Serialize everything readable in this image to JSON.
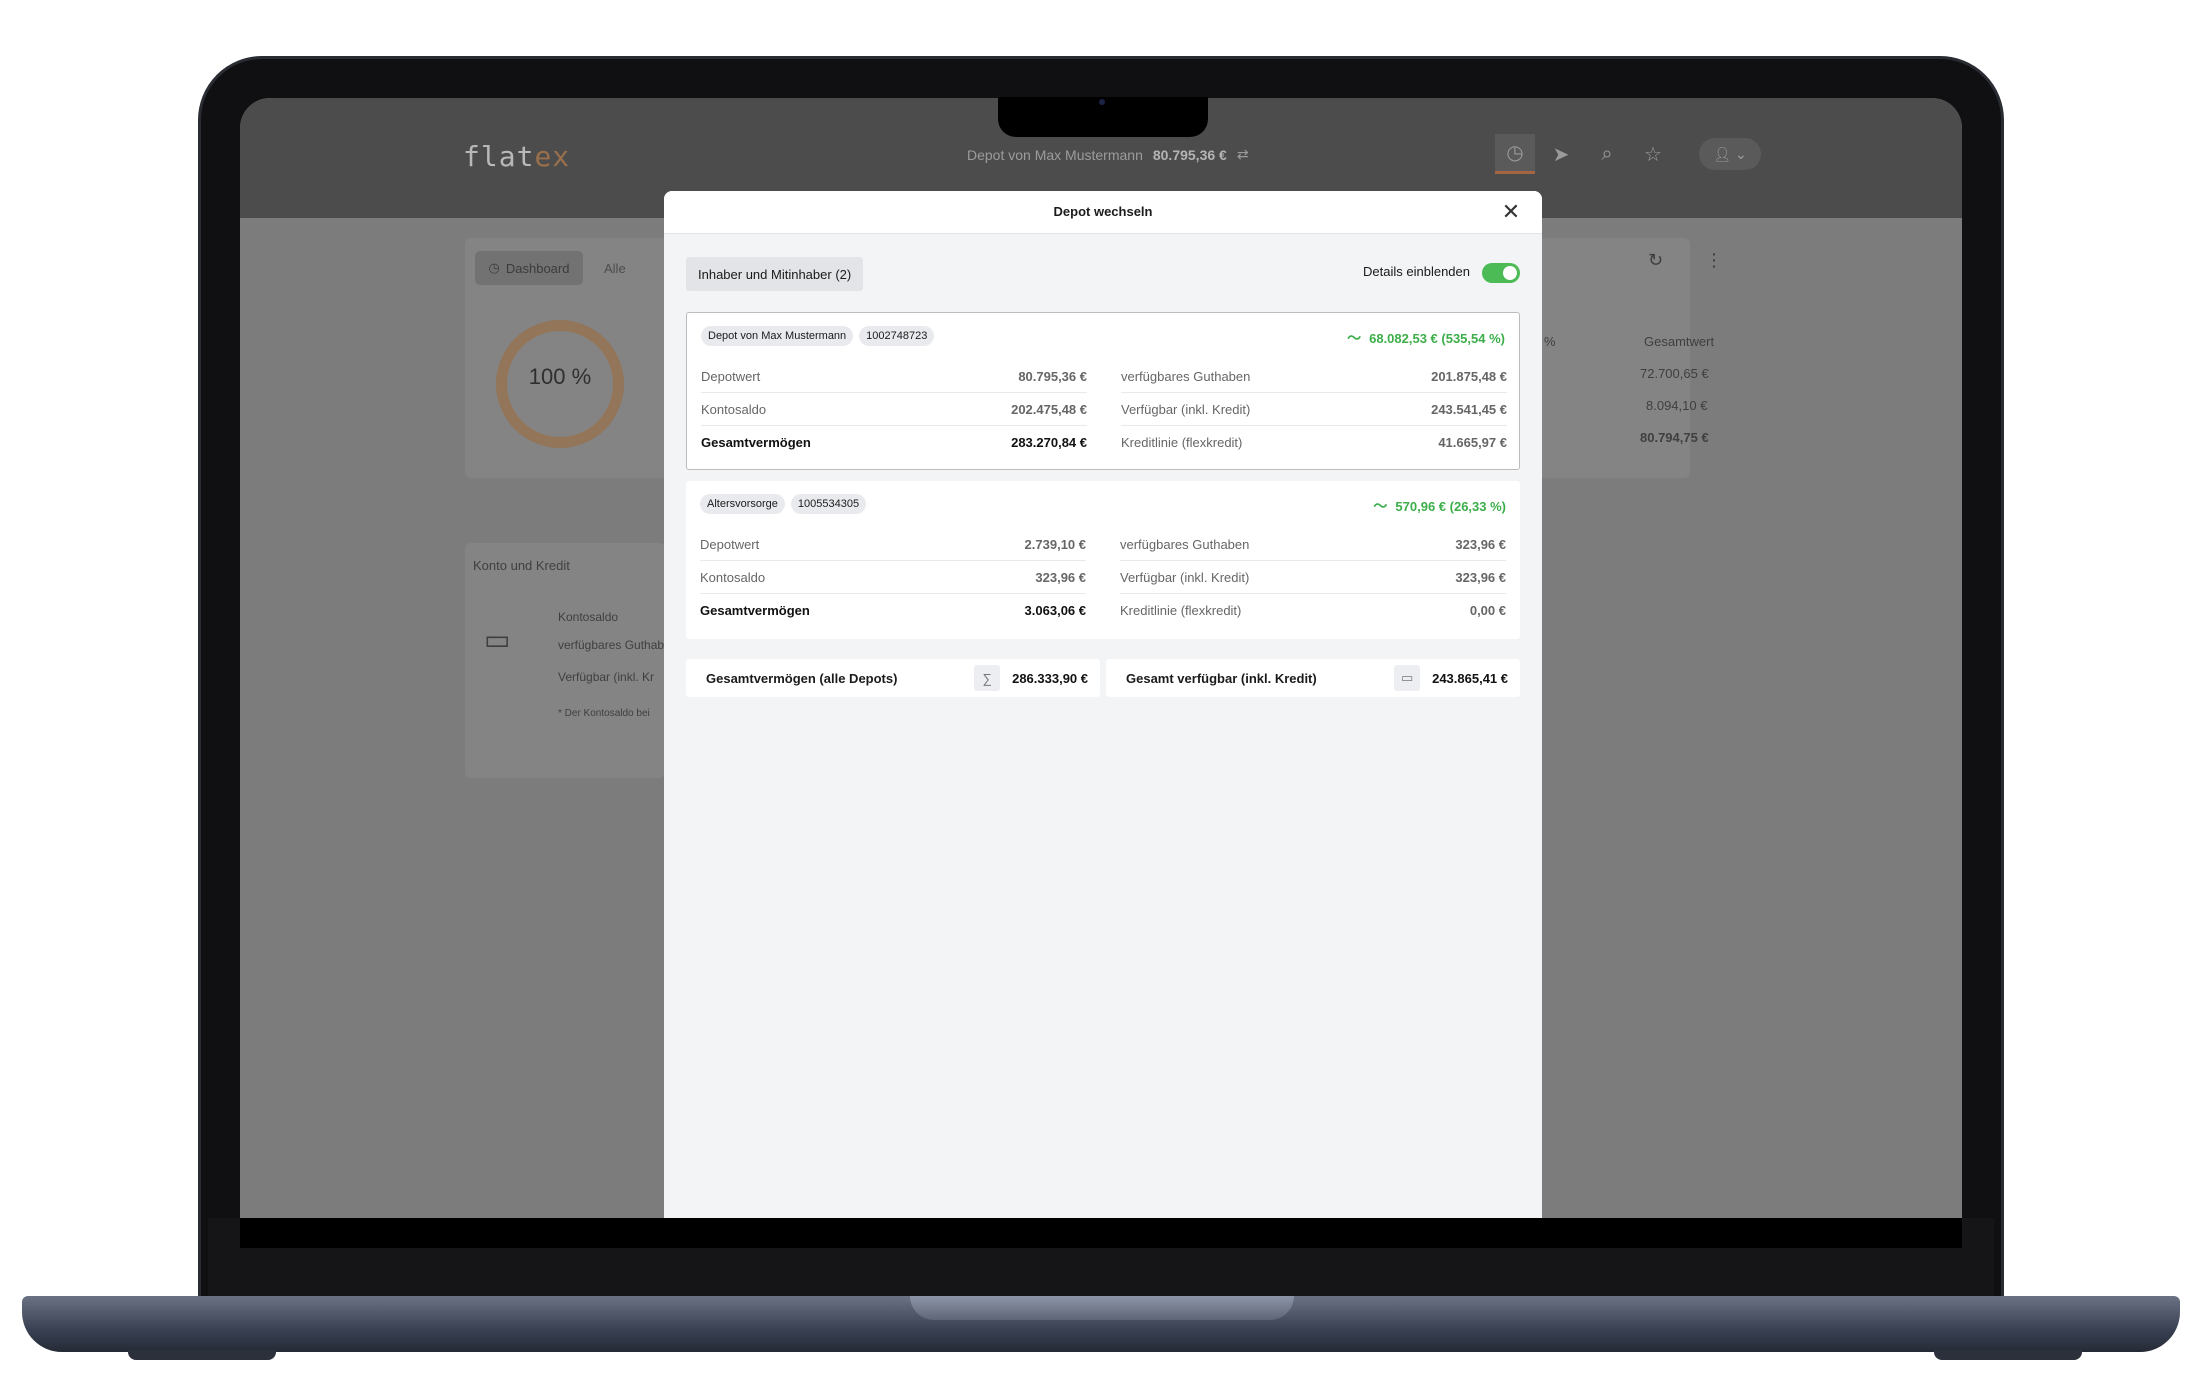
{
  "app": {
    "logo": "flatex",
    "logo_main": "flat",
    "logo_accent": "ex"
  },
  "header": {
    "depot_label": "Depot von Max Mustermann",
    "depot_value": "80.795,36 €",
    "icons": [
      "history-icon",
      "send-icon",
      "search-icon",
      "star-icon",
      "user-icon"
    ]
  },
  "background": {
    "tab_dashboard": "Dashboard",
    "tab_all": "Alle",
    "donut_label": "100 %",
    "col_header": "Gesamtwert",
    "col_header_partial": "%",
    "values": [
      "72.700,65 €",
      "8.094,10 €",
      "80.794,75 €"
    ],
    "section_title": "Konto und Kredit",
    "rows": [
      "Kontosaldo",
      "verfügbares Guthab",
      "Verfügbar (inkl. Kr"
    ],
    "footnote": "* Der Kontosaldo bei"
  },
  "modal": {
    "title": "Depot wechseln",
    "filter_button": "Inhaber und Mitinhaber (2)",
    "toggle_label": "Details einblenden",
    "toggle_on": true,
    "accounts": [
      {
        "name": "Depot von Max Mustermann",
        "number": "1002748723",
        "performance": "68.082,53 € (535,54 %)",
        "left": [
          {
            "label": "Depotwert",
            "value": "80.795,36 €"
          },
          {
            "label": "Kontosaldo",
            "value": "202.475,48 €"
          },
          {
            "label": "Gesamtvermögen",
            "value": "283.270,84 €"
          }
        ],
        "right": [
          {
            "label": "verfügbares Guthaben",
            "value": "201.875,48 €"
          },
          {
            "label": "Verfügbar (inkl. Kredit)",
            "value": "243.541,45 €"
          },
          {
            "label": "Kreditlinie (flexkredit)",
            "value": "41.665,97 €"
          }
        ]
      },
      {
        "name": "Altersvorsorge",
        "number": "1005534305",
        "performance": "570,96 € (26,33 %)",
        "left": [
          {
            "label": "Depotwert",
            "value": "2.739,10 €"
          },
          {
            "label": "Kontosaldo",
            "value": "323,96 €"
          },
          {
            "label": "Gesamtvermögen",
            "value": "3.063,06 €"
          }
        ],
        "right": [
          {
            "label": "verfügbares Guthaben",
            "value": "323,96 €"
          },
          {
            "label": "Verfügbar (inkl. Kredit)",
            "value": "323,96 €"
          },
          {
            "label": "Kreditlinie (flexkredit)",
            "value": "0,00 €"
          }
        ]
      }
    ],
    "totals": [
      {
        "label": "Gesamtvermögen (alle Depots)",
        "icon": "sigma-icon",
        "value": "286.333,90 €"
      },
      {
        "label": "Gesamt verfügbar (inkl. Kredit)",
        "icon": "wallet-icon",
        "value": "243.865,41 €"
      }
    ]
  },
  "colors": {
    "positive": "#3cae4a",
    "toggle": "#4cbb56",
    "accent": "#a46542"
  }
}
